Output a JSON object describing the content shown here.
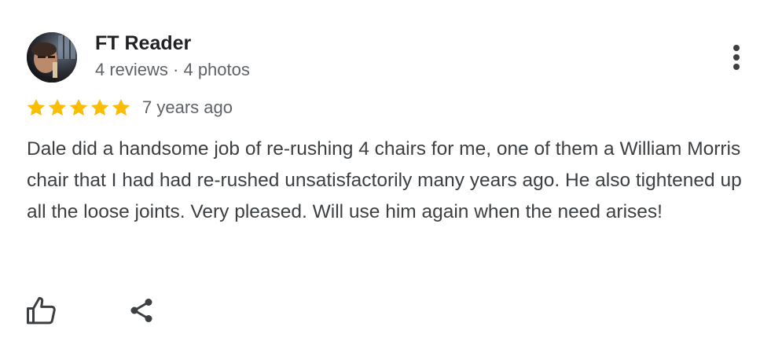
{
  "reviewer": {
    "name": "FT Reader",
    "meta": "4 reviews · 4 photos",
    "avatar_icon": "user-photo"
  },
  "rating": {
    "stars": 5,
    "max_stars": 5,
    "time_ago": "7 years ago",
    "star_color": "#fbbc04"
  },
  "review": {
    "text": "Dale did a handsome job of re-rushing 4 chairs for me, one of them a William Morris chair that I had had re-rushed unsatisfactorily many years ago. He also tightened up all the loose joints. Very pleased. Will use him again when the need arises!"
  },
  "actions": {
    "more_icon": "more-vert-icon",
    "like_icon": "thumbs-up-icon",
    "share_icon": "share-icon"
  },
  "colors": {
    "text_primary": "#202124",
    "text_secondary": "#5f6368",
    "body_text": "#3c4043",
    "icon": "#3c4043"
  }
}
